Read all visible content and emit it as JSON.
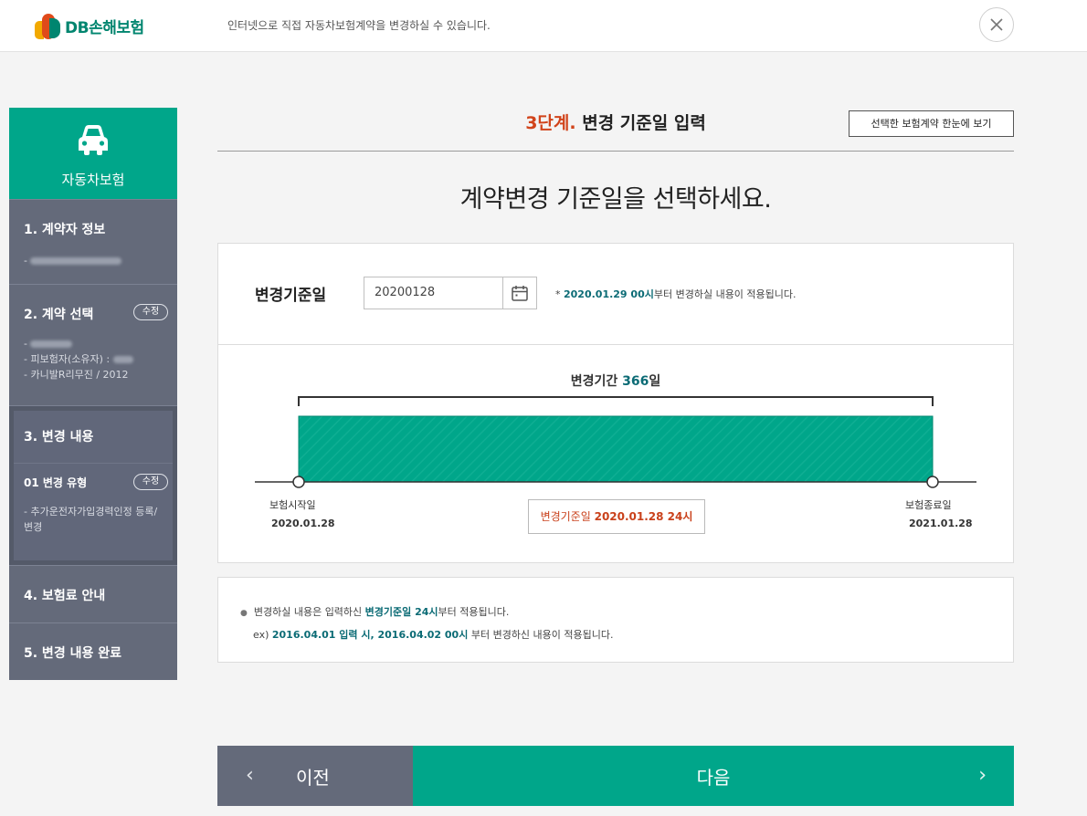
{
  "brand": {
    "name": "DB손해보험"
  },
  "top_message": "인터넷으로 직접 자동차보험계약을 변경하실 수 있습니다.",
  "sidebar": {
    "product": "자동차보험",
    "steps": [
      {
        "title": "1. 계약자 정보",
        "subs": [
          "-"
        ]
      },
      {
        "title": "2. 계약 선택",
        "edit": "수정",
        "subs": [
          "-",
          "- 피보험자(소유자) :",
          "- 카니발R리무진 / 2012"
        ]
      },
      {
        "title": "3. 변경 내용",
        "sub_title": "01 변경 유형",
        "edit": "수정",
        "subs": [
          "- 추가운전자가입경력인정 등록/변경"
        ]
      },
      {
        "title": "4. 보험료 안내"
      },
      {
        "title": "5. 변경 내용 완료"
      }
    ]
  },
  "heading": {
    "step_num": "3단계.",
    "step_title": "변경 기준일 입력",
    "summary_button": "선택한 보험계약 한눈에 보기"
  },
  "question": "계약변경 기준일을 선택하세요.",
  "form": {
    "label": "변경기준일",
    "date_value": "20200128",
    "note_prefix": "* ",
    "note_date": "2020.01.29 00시",
    "note_suffix": "부터 변경하실 내용이 적용됩니다."
  },
  "timeline": {
    "period_label": "변경기간",
    "period_days": "366",
    "period_unit": "일",
    "start_label": "보험시작일",
    "start_date": "2020.01.28",
    "end_label": "보험종료일",
    "end_date": "2021.01.28",
    "change_label": "변경기준일",
    "change_date": "2020.01.28 24시"
  },
  "info": {
    "line1_a": "변경하실 내용은 입력하신 ",
    "line1_b": "변경기준일 24시",
    "line1_c": "부터 적용됩니다.",
    "line2_a": "ex) ",
    "line2_b": "2016.04.01 입력 시, 2016.04.02 00시",
    "line2_c": " 부터 변경하신 내용이 적용됩니다."
  },
  "nav": {
    "prev": "이전",
    "next": "다음"
  },
  "colors": {
    "primary": "#00a68a",
    "step_gray": "#646a7a",
    "accent": "#d1441b",
    "teal_text": "#0b6b75"
  }
}
